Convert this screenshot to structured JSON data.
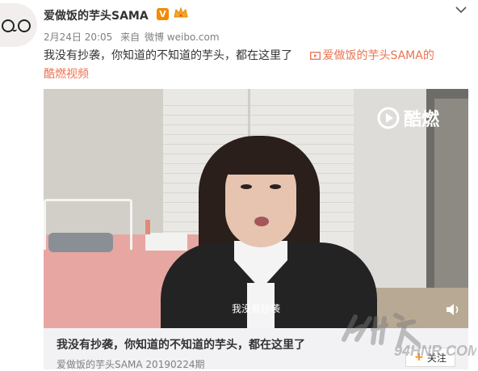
{
  "post": {
    "username": "爱做饭的芋头SAMA",
    "verified_badge": "V",
    "meta": {
      "date": "2月24日 20:05",
      "via": "来自",
      "source": "微博 weibo.com"
    },
    "text": "我没有抄袭，你知道的不知道的芋头，都在这里了",
    "video_link": "爱做饭的芋头SAMA的",
    "video_link_cont": "酷燃视频"
  },
  "video": {
    "brand": "酷燃",
    "subtitle": "我没有抄袭",
    "title": "我没有抄袭，你知道的不知道的芋头，都在这里了",
    "source": "爱做饭的芋头SAMA 20190224期",
    "follow_label": "关注",
    "follow_plus": "+"
  },
  "icons": {
    "verified": "v-badge-icon",
    "crown": "crown-icon",
    "chevron": "chevron-down-icon",
    "video": "video-link-icon",
    "play_logo": "kuran-play-icon",
    "volume": "volume-icon"
  },
  "colors": {
    "link": "#eb7350",
    "badge": "#f28a00",
    "follow_plus": "#ff8200"
  }
}
